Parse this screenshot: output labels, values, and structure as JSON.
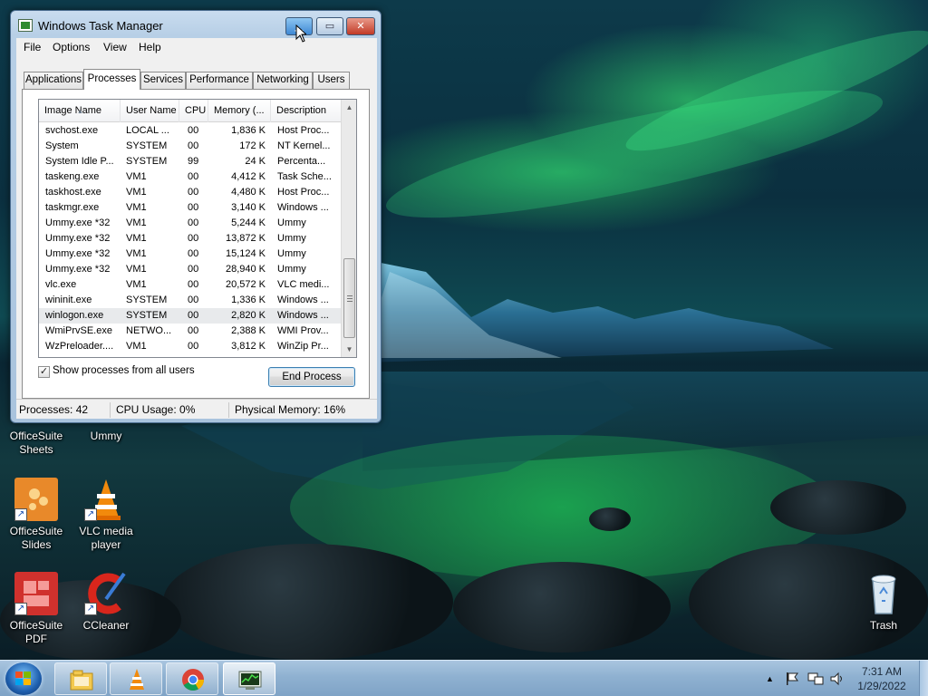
{
  "task_manager": {
    "title": "Windows Task Manager",
    "menu": [
      "File",
      "Options",
      "View",
      "Help"
    ],
    "tabs": [
      "Applications",
      "Processes",
      "Services",
      "Performance",
      "Networking",
      "Users"
    ],
    "active_tab": "Processes",
    "columns": [
      "Image Name",
      "User Name",
      "CPU",
      "Memory (...",
      "Description"
    ],
    "processes": [
      {
        "name": "svchost.exe",
        "user": "LOCAL ...",
        "cpu": "00",
        "mem": "1,836 K",
        "desc": "Host Proc..."
      },
      {
        "name": "System",
        "user": "SYSTEM",
        "cpu": "00",
        "mem": "172 K",
        "desc": "NT Kernel..."
      },
      {
        "name": "System Idle P...",
        "user": "SYSTEM",
        "cpu": "99",
        "mem": "24 K",
        "desc": "Percenta..."
      },
      {
        "name": "taskeng.exe",
        "user": "VM1",
        "cpu": "00",
        "mem": "4,412 K",
        "desc": "Task Sche..."
      },
      {
        "name": "taskhost.exe",
        "user": "VM1",
        "cpu": "00",
        "mem": "4,480 K",
        "desc": "Host Proc..."
      },
      {
        "name": "taskmgr.exe",
        "user": "VM1",
        "cpu": "00",
        "mem": "3,140 K",
        "desc": "Windows ..."
      },
      {
        "name": "Ummy.exe *32",
        "user": "VM1",
        "cpu": "00",
        "mem": "5,244 K",
        "desc": "Ummy"
      },
      {
        "name": "Ummy.exe *32",
        "user": "VM1",
        "cpu": "00",
        "mem": "13,872 K",
        "desc": "Ummy"
      },
      {
        "name": "Ummy.exe *32",
        "user": "VM1",
        "cpu": "00",
        "mem": "15,124 K",
        "desc": "Ummy"
      },
      {
        "name": "Ummy.exe *32",
        "user": "VM1",
        "cpu": "00",
        "mem": "28,940 K",
        "desc": "Ummy"
      },
      {
        "name": "vlc.exe",
        "user": "VM1",
        "cpu": "00",
        "mem": "20,572 K",
        "desc": "VLC medi..."
      },
      {
        "name": "wininit.exe",
        "user": "SYSTEM",
        "cpu": "00",
        "mem": "1,336 K",
        "desc": "Windows ..."
      },
      {
        "name": "winlogon.exe",
        "user": "SYSTEM",
        "cpu": "00",
        "mem": "2,820 K",
        "desc": "Windows ..."
      },
      {
        "name": "WmiPrvSE.exe",
        "user": "NETWO...",
        "cpu": "00",
        "mem": "2,388 K",
        "desc": "WMI Prov..."
      },
      {
        "name": "WzPreloader....",
        "user": "VM1",
        "cpu": "00",
        "mem": "3,812 K",
        "desc": "WinZip Pr..."
      }
    ],
    "selected_row_index": 12,
    "show_all_label": "Show processes from all users",
    "show_all_checked": true,
    "end_process_label": "End Process",
    "status": {
      "processes": "Processes: 42",
      "cpu": "CPU Usage: 0%",
      "memory": "Physical Memory: 16%"
    }
  },
  "desktop_icons": [
    {
      "id": "sheets",
      "label_line1": "OfficeSuite",
      "label_line2": "Sheets",
      "color": "#2a8a3a",
      "icon": "officesuite-sheets-icon"
    },
    {
      "id": "ummy",
      "label_line1": "Ummy",
      "label_line2": "",
      "color": "#d43a2a",
      "icon": "ummy-icon"
    },
    {
      "id": "slides",
      "label_line1": "OfficeSuite",
      "label_line2": "Slides",
      "color": "#e8892a",
      "icon": "officesuite-slides-icon"
    },
    {
      "id": "vlc",
      "label_line1": "VLC media",
      "label_line2": "player",
      "color": "#f28a0c",
      "icon": "vlc-icon"
    },
    {
      "id": "pdf",
      "label_line1": "OfficeSuite",
      "label_line2": "PDF",
      "color": "#d0312d",
      "icon": "officesuite-pdf-icon"
    },
    {
      "id": "ccleaner",
      "label_line1": "CCleaner",
      "label_line2": "",
      "color": "#d8261c",
      "icon": "ccleaner-icon"
    },
    {
      "id": "trash",
      "label_line1": "Trash",
      "label_line2": "",
      "color": "#c8d8e8",
      "icon": "recycle-bin-icon"
    }
  ],
  "taskbar": {
    "pinned": [
      "explorer-icon",
      "vlc-icon",
      "chrome-icon",
      "task-manager-icon"
    ],
    "time": "7:31 AM",
    "date": "1/29/2022"
  }
}
